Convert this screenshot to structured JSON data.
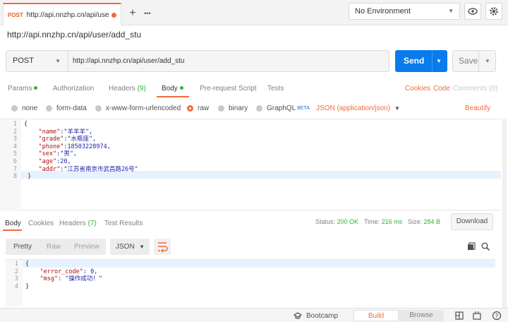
{
  "tab": {
    "method": "POST",
    "url": "http://api.nnzhp.cn/api/user/a..."
  },
  "toolbar": {
    "add_label": "+",
    "more_label": "•••"
  },
  "environment": {
    "selected": "No Environment"
  },
  "request": {
    "title": "http://api.nnzhp.cn/api/user/add_stu",
    "method": "POST",
    "url": "http://api.nnzhp.cn/api/user/add_stu",
    "send_label": "Send",
    "save_label": "Save"
  },
  "request_tabs": {
    "params": "Params",
    "authorization": "Authorization",
    "headers": "Headers",
    "headers_count": "(9)",
    "body": "Body",
    "pre_request": "Pre-request Script",
    "tests": "Tests",
    "cookies": "Cookies",
    "code": "Code",
    "comments": "Comments (0)"
  },
  "body_options": {
    "none": "none",
    "form_data": "form-data",
    "urlencoded": "x-www-form-urlencoded",
    "raw": "raw",
    "binary": "binary",
    "graphql": "GraphQL",
    "beta": "BETA",
    "content_type": "JSON (application/json)",
    "beautify": "Beautify"
  },
  "request_body": {
    "line_numbers": [
      "1",
      "2",
      "3",
      "4",
      "5",
      "6",
      "7",
      "8"
    ],
    "lines": [
      {
        "a": "{",
        "b": "",
        "c": ""
      },
      {
        "a": "    ",
        "b": "\"name\"",
        "c": ":\"羊羊羊\","
      },
      {
        "a": "    ",
        "b": "\"grade\"",
        "c": ":\"水瓶座\","
      },
      {
        "a": "    ",
        "b": "\"phone\"",
        "c": ":18503228974,"
      },
      {
        "a": "    ",
        "b": "\"sex\"",
        "c": ":\"男\","
      },
      {
        "a": "    ",
        "b": "\"age\"",
        "c": ":20,"
      },
      {
        "a": "    ",
        "b": "\"addr\"",
        "c": ":\"江苏省南京市武昌路26号\""
      },
      {
        "a": " }",
        "b": "",
        "c": ""
      }
    ]
  },
  "response_tabs": {
    "body": "Body",
    "cookies": "Cookies",
    "headers": "Headers",
    "headers_count": "(7)",
    "test_results": "Test Results"
  },
  "response_meta": {
    "status_label": "Status:",
    "status": "200 OK",
    "time_label": "Time:",
    "time": "216 ms",
    "size_label": "Size:",
    "size": "284 B",
    "download": "Download"
  },
  "response_format": {
    "pretty": "Pretty",
    "raw": "Raw",
    "preview": "Preview",
    "json": "JSON"
  },
  "response_body": {
    "line_numbers": [
      "1",
      "2",
      "3",
      "4"
    ],
    "lines": [
      {
        "a": "{",
        "b": "",
        "c": ""
      },
      {
        "a": "    ",
        "b": "\"error_code\"",
        "c": ": 0,"
      },
      {
        "a": "    ",
        "b": "\"msg\"",
        "c": ": \"操作成功！\""
      },
      {
        "a": "}",
        "b": "",
        "c": ""
      }
    ]
  },
  "statusbar": {
    "bootcamp": "Bootcamp",
    "build": "Build",
    "browse": "Browse"
  }
}
